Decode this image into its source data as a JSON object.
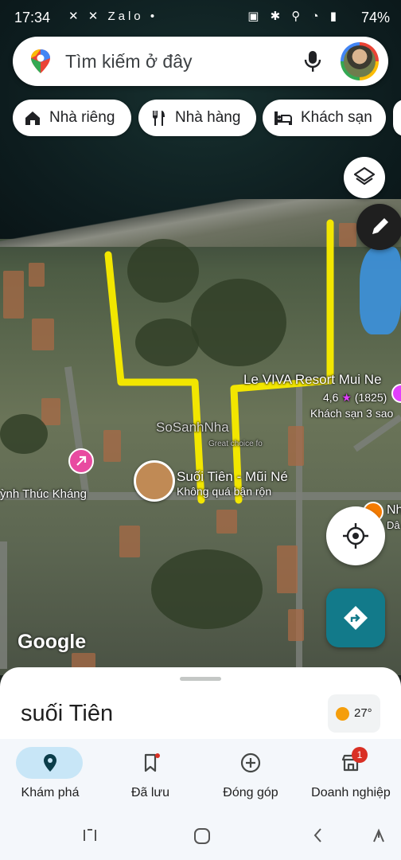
{
  "status_bar": {
    "time": "17:34",
    "left_icons": "✕ ✕ Zalo •",
    "right_icons": "▣ ✱ ⚲ ◔ ▮",
    "battery": "74%"
  },
  "search": {
    "placeholder": "Tìm kiếm ở đây",
    "icons": [
      "maps-pin-icon",
      "mic-icon",
      "avatar"
    ]
  },
  "chips": [
    {
      "label": "Nhà riêng",
      "icon": "home-icon"
    },
    {
      "label": "Nhà hàng",
      "icon": "restaurant-icon"
    },
    {
      "label": "Khách sạn",
      "icon": "hotel-icon"
    }
  ],
  "map": {
    "resort": {
      "name": "Le VIVA Resort Mui Ne",
      "rating": "4,6",
      "star": "★",
      "reviews": "(1825)",
      "type": "Khách sạn 3 sao"
    },
    "place": {
      "name": "Suối Tiên - Mũi Né",
      "busy": "Không quá bận rộn"
    },
    "street": "ỳnh Thúc Kháng",
    "watermark": "SoSanhNha",
    "watermark_sub": "Great choice fo",
    "right_edge_label": "Nh",
    "right_edge_sub": "Dâ",
    "logo": "Google"
  },
  "colors": {
    "accent": "#127a8a",
    "route": "#f2e600",
    "pill": "#c8e6f7",
    "badge": "#d93025"
  },
  "sheet": {
    "title": "suối Tiên",
    "weather": "27°"
  },
  "bottom_nav": [
    {
      "label": "Khám phá",
      "icon": "explore-pin-icon",
      "active": true
    },
    {
      "label": "Đã lưu",
      "icon": "bookmark-icon"
    },
    {
      "label": "Đóng góp",
      "icon": "add-circle-icon"
    },
    {
      "label": "Doanh nghiệp",
      "icon": "store-icon",
      "badge": "1"
    }
  ]
}
